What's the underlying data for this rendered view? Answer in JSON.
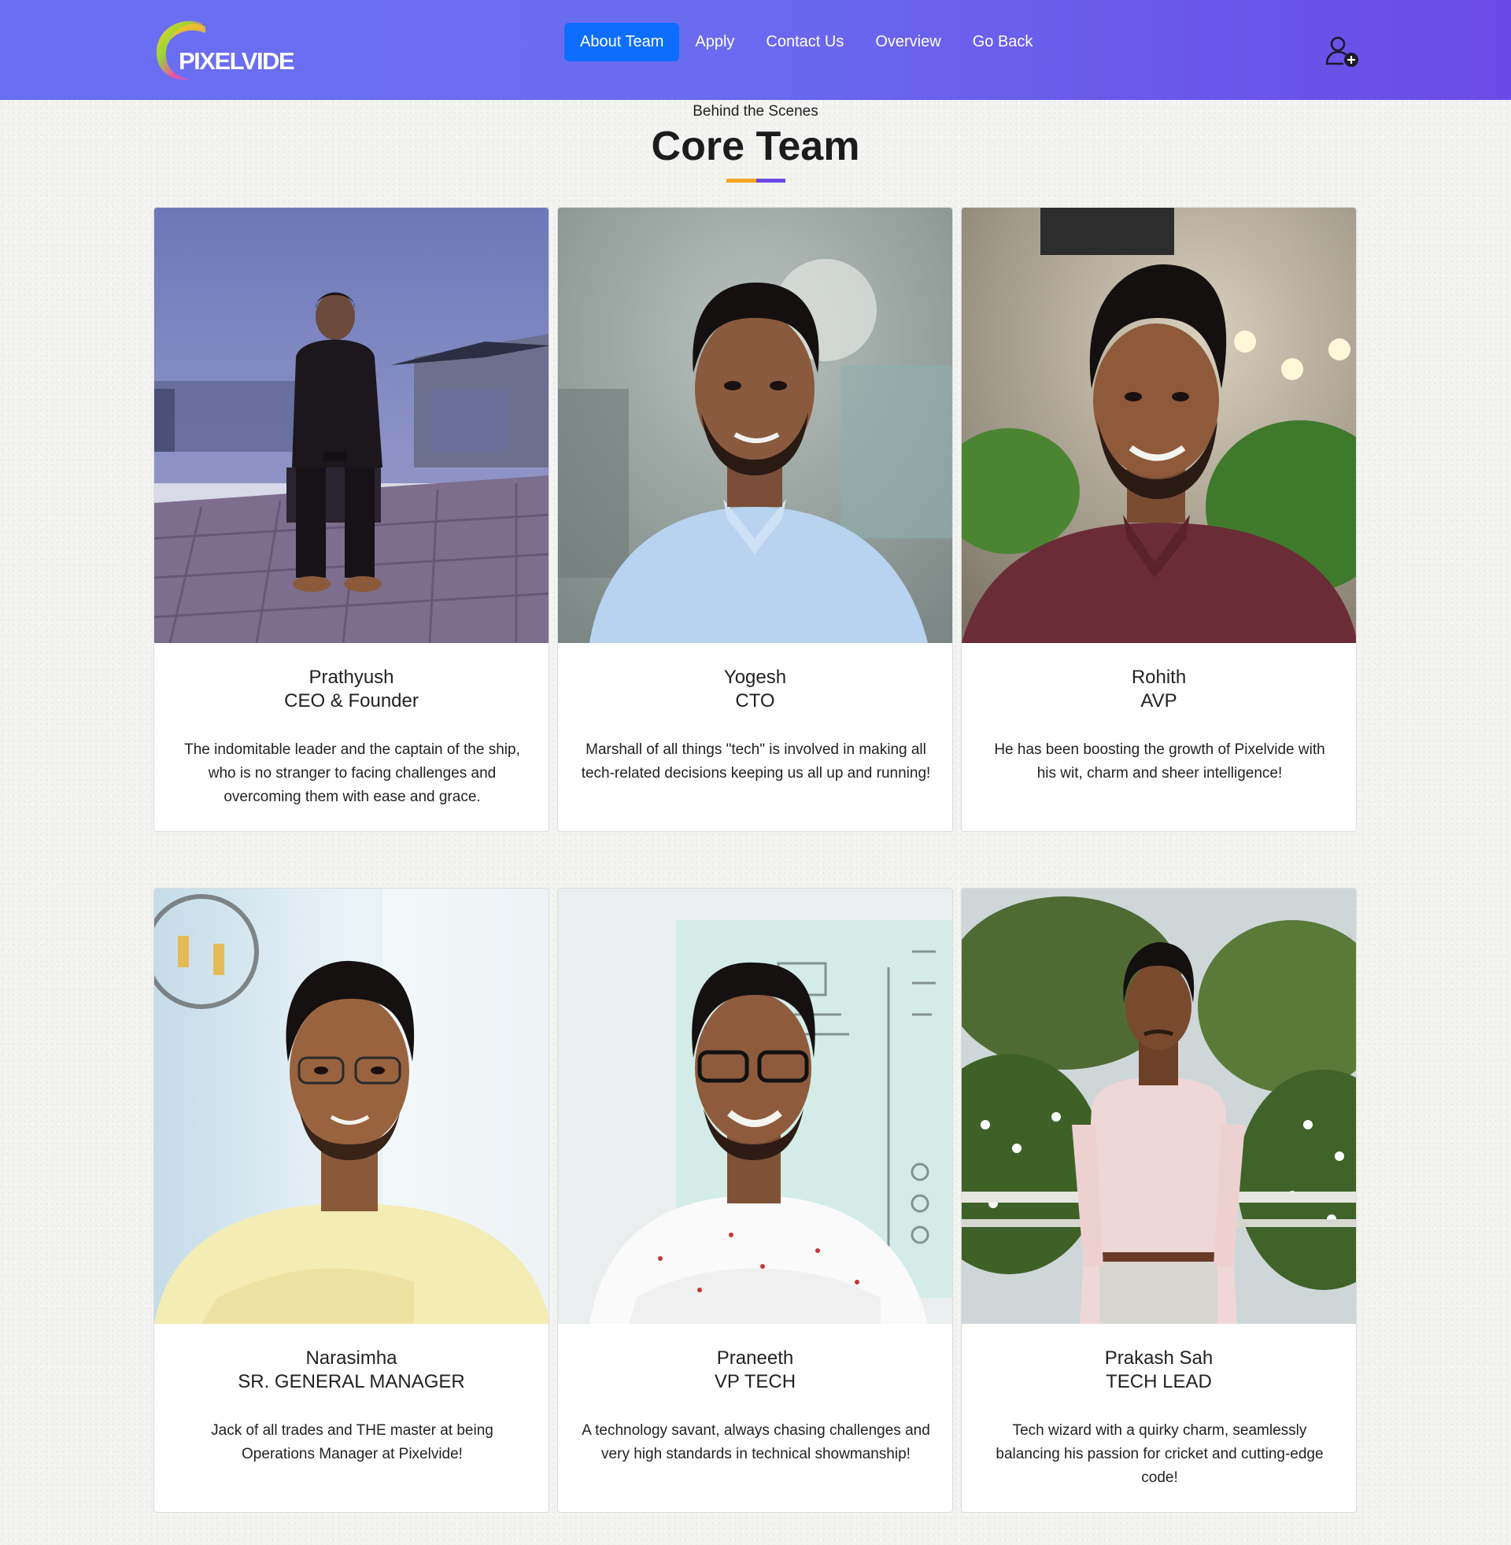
{
  "brand": {
    "name": "PIXELVIDE"
  },
  "nav": {
    "items": [
      {
        "label": "About Team",
        "active": true
      },
      {
        "label": "Apply",
        "active": false
      },
      {
        "label": "Contact Us",
        "active": false
      },
      {
        "label": "Overview",
        "active": false
      },
      {
        "label": "Go Back",
        "active": false
      }
    ],
    "user_icon": "user-plus-icon"
  },
  "section": {
    "eyebrow": "Behind the Scenes",
    "title": "Core Team",
    "underline_colors": [
      "#f5a524",
      "#6a4ae6"
    ]
  },
  "team": [
    {
      "name": "Prathyush",
      "role": "CEO & Founder",
      "description": "The indomitable leader and the captain of the ship, who is no stranger to facing challenges and overcoming them with ease and grace.",
      "photo": "person-seated-rooftop-photo"
    },
    {
      "name": "Yogesh",
      "role": "CTO",
      "description": "Marshall of all things \"tech\" is involved in making all tech-related decisions keeping us all up and running!",
      "photo": "portrait-light-blue-shirt-photo"
    },
    {
      "name": "Rohith",
      "role": "AVP",
      "description": "He has been boosting the growth of Pixelvide with his wit, charm and sheer intelligence!",
      "photo": "portrait-maroon-shirt-photo"
    },
    {
      "name": "Narasimha",
      "role": "SR. GENERAL MANAGER",
      "description": "Jack of all trades and THE master at being Operations Manager at Pixelvide!",
      "photo": "portrait-yellow-shirt-photo"
    },
    {
      "name": "Praneeth",
      "role": "VP TECH",
      "description": "A technology savant, always chasing challenges and very high standards in technical showmanship!",
      "photo": "portrait-white-shirt-whiteboard-photo"
    },
    {
      "name": "Prakash Sah",
      "role": "TECH LEAD",
      "description": "Tech wizard with a quirky charm, seamlessly balancing his passion for cricket and cutting-edge code!",
      "photo": "person-standing-garden-photo"
    }
  ],
  "colors": {
    "header_start": "#6a6ff2",
    "header_end": "#6a4ae6",
    "active_nav": "#0d6efd"
  }
}
